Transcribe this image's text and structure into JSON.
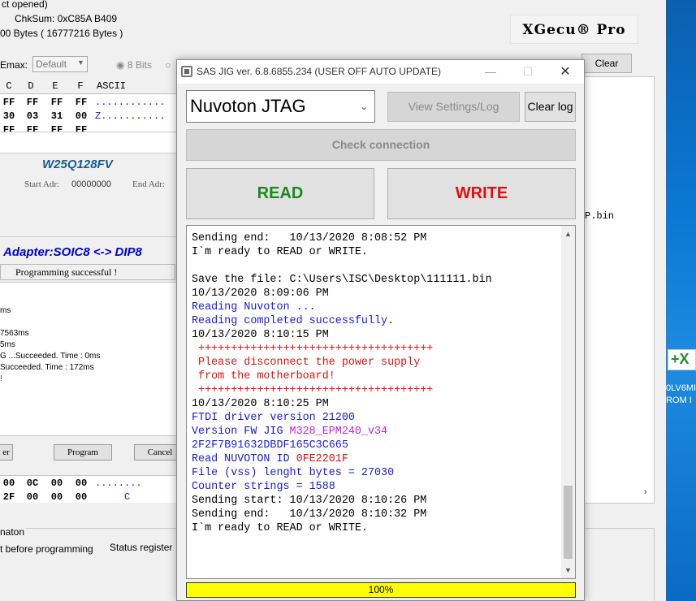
{
  "background_app": {
    "top_lines": [
      "ct opened)",
      "ChkSum:  0xC85A B409",
      "00 Bytes ( 16777216 Bytes )"
    ],
    "logo": "XGecu® Pro",
    "emax_label": "Emax:",
    "emax_value": "Default",
    "bits_label": "8 Bits",
    "clear_label": "Clear",
    "hex_headers": [
      "C",
      "D",
      "E",
      "F",
      "ASCII"
    ],
    "hex_row1": [
      "FF",
      "FF",
      "FF",
      "FF",
      "............"
    ],
    "hex_row2": [
      "30",
      "03",
      "31",
      "00",
      "Z..........."
    ],
    "hex_row3": [
      "FF",
      "FF",
      "FF",
      "FF"
    ],
    "chip_name": "W25Q128FV",
    "start_adr_label": "Start Adr:",
    "start_adr_value": "00000000",
    "end_adr_label": "End Adr:",
    "bin_fragment": "P.bin",
    "adapter": "Adapter:SOIC8 <-> DIP8",
    "status": "Programming successful !",
    "log_lines": [
      "ms",
      "",
      "7563ms",
      "5ms",
      "G ...Succeeded. Time : 0ms",
      "Succeeded. Time : 172ms",
      "!"
    ],
    "btn_fragment": "er",
    "program_label": "Program",
    "cancel_label": "Cancel",
    "hex2_row1": [
      "00",
      "0C",
      "00",
      "00",
      "........"
    ],
    "hex2_row2": [
      "2F",
      "00",
      "00",
      "00",
      "C"
    ],
    "bottom_heading": "naton",
    "bottom_text1": "t before programming",
    "bottom_text2": "Status register"
  },
  "desktop": {
    "label_line1": "0LV6MI",
    "label_line2": "ROM I"
  },
  "dialog": {
    "title": "SAS JIG ver. 6.8.6855.234 (USER OFF AUTO UPDATE)",
    "device": "Nuvoton JTAG",
    "view_settings_label": "View Settings/Log",
    "clear_log_label": "Clear log",
    "check_connection_label": "Check connection",
    "read_label": "READ",
    "write_label": "WRITE",
    "progress_text": "100%",
    "progress_value": 100,
    "colors": {
      "read": "#198a19",
      "write": "#e01010",
      "log_black": "#000000",
      "log_blue": "#1a1adc",
      "log_red": "#e01010",
      "log_magenta": "#d020d0",
      "progress": "#ffff00"
    },
    "log": [
      {
        "segments": [
          {
            "t": "Sending end:   10/13/2020 8:08:52 PM",
            "c": "black"
          }
        ]
      },
      {
        "segments": [
          {
            "t": "I`m ready to READ or WRITE.",
            "c": "black"
          }
        ]
      },
      {
        "segments": [
          {
            "t": "",
            "c": "black"
          }
        ]
      },
      {
        "segments": [
          {
            "t": "Save the file: C:\\Users\\ISC\\Desktop\\111111.bin",
            "c": "black"
          }
        ]
      },
      {
        "segments": [
          {
            "t": "10/13/2020 8:09:06 PM",
            "c": "black"
          }
        ]
      },
      {
        "segments": [
          {
            "t": "Reading Nuvoton ...",
            "c": "blue"
          }
        ]
      },
      {
        "segments": [
          {
            "t": "Reading completed successfully.",
            "c": "blue"
          }
        ]
      },
      {
        "segments": [
          {
            "t": "10/13/2020 8:10:15 PM",
            "c": "black"
          }
        ]
      },
      {
        "segments": [
          {
            "t": " ++++++++++++++++++++++++++++++++++++",
            "c": "red"
          }
        ]
      },
      {
        "segments": [
          {
            "t": " Please disconnect the power supply",
            "c": "red"
          }
        ]
      },
      {
        "segments": [
          {
            "t": " from the motherboard!",
            "c": "red"
          }
        ]
      },
      {
        "segments": [
          {
            "t": " ++++++++++++++++++++++++++++++++++++",
            "c": "red"
          }
        ]
      },
      {
        "segments": [
          {
            "t": "10/13/2020 8:10:25 PM",
            "c": "black"
          }
        ]
      },
      {
        "segments": [
          {
            "t": "FTDI driver version 21200",
            "c": "blue"
          }
        ]
      },
      {
        "segments": [
          {
            "t": "Version FW JIG ",
            "c": "blue"
          },
          {
            "t": "M328_EPM240_v34",
            "c": "magenta"
          }
        ]
      },
      {
        "segments": [
          {
            "t": "2F2F7B91632DBDF165C3C665",
            "c": "blue"
          }
        ]
      },
      {
        "segments": [
          {
            "t": "Read NUVOTON ID ",
            "c": "blue"
          },
          {
            "t": "0FE2201F",
            "c": "red"
          }
        ]
      },
      {
        "segments": [
          {
            "t": "File (vss) lenght bytes = 27030",
            "c": "blue"
          }
        ]
      },
      {
        "segments": [
          {
            "t": "Counter strings = 1588",
            "c": "blue"
          }
        ]
      },
      {
        "segments": [
          {
            "t": "Sending start: 10/13/2020 8:10:26 PM",
            "c": "black"
          }
        ]
      },
      {
        "segments": [
          {
            "t": "Sending end:   10/13/2020 8:10:32 PM",
            "c": "black"
          }
        ]
      },
      {
        "segments": [
          {
            "t": "I`m ready to READ or WRITE.",
            "c": "black"
          }
        ]
      }
    ]
  }
}
